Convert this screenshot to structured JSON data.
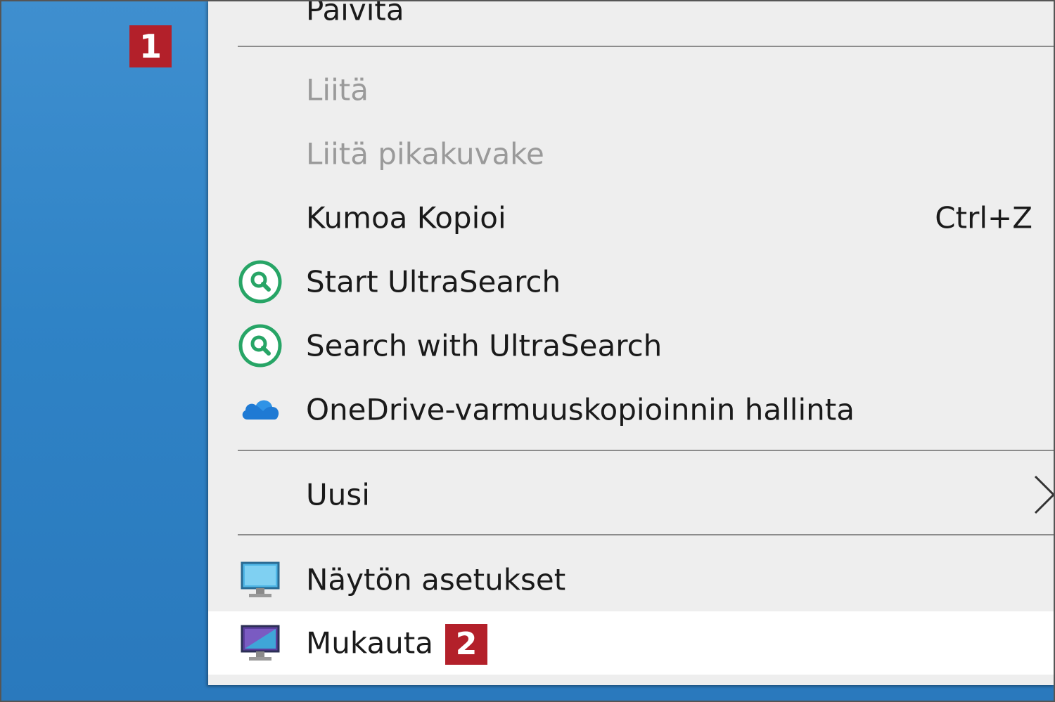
{
  "menu": {
    "items": [
      {
        "label": "Päivitä",
        "enabled": true
      },
      {
        "label": "Liitä",
        "enabled": false
      },
      {
        "label": "Liitä pikakuvake",
        "enabled": false
      },
      {
        "label": "Kumoa Kopioi",
        "shortcut": "Ctrl+Z",
        "enabled": true
      },
      {
        "label": "Start UltraSearch",
        "icon": "ultrasearch-icon",
        "enabled": true
      },
      {
        "label": "Search with UltraSearch",
        "icon": "ultrasearch-icon",
        "enabled": true
      },
      {
        "label": "OneDrive-varmuuskopioinnin hallinta",
        "icon": "onedrive-icon",
        "enabled": true
      },
      {
        "label": "Uusi",
        "submenu": true,
        "enabled": true
      },
      {
        "label": "Näytön asetukset",
        "icon": "display-settings-icon",
        "enabled": true
      },
      {
        "label": "Mukauta",
        "icon": "personalize-icon",
        "enabled": true,
        "highlighted": true
      }
    ]
  },
  "annotations": {
    "step1": "1",
    "step2": "2"
  },
  "colors": {
    "desktop_blue": "#2f83c6",
    "menu_bg": "#eeeeee",
    "badge_red": "#b3202a",
    "ultrasearch_green": "#27a566",
    "onedrive_blue": "#1f7ad4"
  }
}
